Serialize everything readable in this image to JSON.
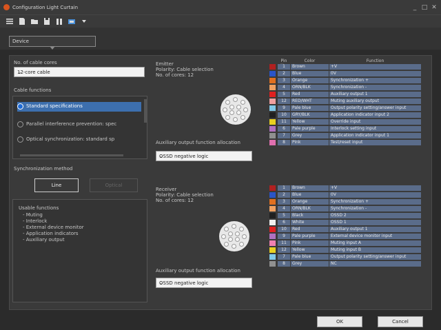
{
  "window": {
    "title": "Configuration Light Curtain",
    "minimize": "_",
    "maximize": "□",
    "close": "✕"
  },
  "device": {
    "label": "Device"
  },
  "cable": {
    "cores_label": "No. of cable cores",
    "cores_value": "12-core cable",
    "functions_label": "Cable functions",
    "options": [
      "Standard specifications",
      "Parallel interference prevention: spec",
      "Optical synchronization: standard sp"
    ],
    "selected_index": 0
  },
  "sync": {
    "label": "Synchronization method",
    "line_button": "Line",
    "optical_button": "Optical"
  },
  "usable": {
    "title": "Usable functions",
    "items": [
      "- Muting",
      "- Interlock",
      "- External device monitor",
      "- Application indicators",
      "- Auxiliary output"
    ]
  },
  "emitter": {
    "title": "Emitter",
    "polarity": "Polarity: Cable selection",
    "cores": "No. of cores: 12",
    "aux_label": "Auxiliary output function allocation",
    "aux_value": "OSSD negative logic"
  },
  "receiver": {
    "title": "Receiver",
    "polarity": "Polarity: Cable selection",
    "cores": "No. of cores: 12",
    "aux_label": "Auxiliary output function allocation",
    "aux_value": "OSSD negative logic"
  },
  "table_headers": {
    "no": "Pin No.",
    "color": "Color",
    "function": "Function"
  },
  "emitter_pins": [
    {
      "swatch": "#b02020",
      "no": "1",
      "color": "Brown",
      "fn": "+V"
    },
    {
      "swatch": "#2a55c8",
      "no": "2",
      "color": "Blue",
      "fn": "0V"
    },
    {
      "swatch": "#e07020",
      "no": "3",
      "color": "Orange",
      "fn": "Synchronization +"
    },
    {
      "swatch": "#f0a060",
      "no": "4",
      "color": "ORN/BLK",
      "fn": "Synchronization -"
    },
    {
      "swatch": "#e02020",
      "no": "5",
      "color": "Red",
      "fn": "Auxiliary output 1"
    },
    {
      "swatch": "#f0a0a0",
      "no": "12",
      "color": "RED/WHT",
      "fn": "Muting auxiliary output"
    },
    {
      "swatch": "#80c8e8",
      "no": "9",
      "color": "Pale blue",
      "fn": "Output polarity setting/answer input"
    },
    {
      "swatch": "#202020",
      "no": "10",
      "color": "GRY/BLK",
      "fn": "Application indicator input 2"
    },
    {
      "swatch": "#e8d020",
      "no": "11",
      "color": "Yellow",
      "fn": "Override input"
    },
    {
      "swatch": "#b070c0",
      "no": "6",
      "color": "Pale purple",
      "fn": "Interlock setting input"
    },
    {
      "swatch": "#909090",
      "no": "7",
      "color": "Grey",
      "fn": "Application indicator input 1"
    },
    {
      "swatch": "#e070b0",
      "no": "8",
      "color": "Pink",
      "fn": "Test/reset input"
    }
  ],
  "receiver_pins": [
    {
      "swatch": "#b02020",
      "no": "1",
      "color": "Brown",
      "fn": "+V"
    },
    {
      "swatch": "#2a55c8",
      "no": "2",
      "color": "Blue",
      "fn": "0V"
    },
    {
      "swatch": "#e07020",
      "no": "3",
      "color": "Orange",
      "fn": "Synchronization +"
    },
    {
      "swatch": "#f0a060",
      "no": "4",
      "color": "ORN/BLK",
      "fn": "Synchronization -"
    },
    {
      "swatch": "#202020",
      "no": "5",
      "color": "Black",
      "fn": "OSSD 2"
    },
    {
      "swatch": "#f0f0f0",
      "no": "6",
      "color": "White",
      "fn": "OSSD 1"
    },
    {
      "swatch": "#e02020",
      "no": "10",
      "color": "Red",
      "fn": "Auxiliary output 1"
    },
    {
      "swatch": "#b070c0",
      "no": "9",
      "color": "Pale purple",
      "fn": "External device monitor input"
    },
    {
      "swatch": "#f080b0",
      "no": "11",
      "color": "Pink",
      "fn": "Muting input A"
    },
    {
      "swatch": "#e8d020",
      "no": "12",
      "color": "Yellow",
      "fn": "Muting input B"
    },
    {
      "swatch": "#80c8e8",
      "no": "7",
      "color": "Pale blue",
      "fn": "Output polarity setting/answer input"
    },
    {
      "swatch": "#909090",
      "no": "8",
      "color": "Grey",
      "fn": "NC"
    }
  ],
  "footer": {
    "ok": "OK",
    "cancel": "Cancel"
  }
}
